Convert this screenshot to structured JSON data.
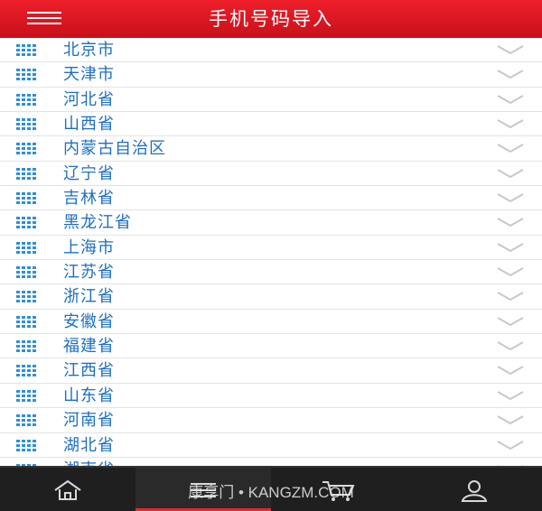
{
  "header": {
    "title": "手机号码导入"
  },
  "provinces": [
    "北京市",
    "天津市",
    "河北省",
    "山西省",
    "内蒙古自治区",
    "辽宁省",
    "吉林省",
    "黑龙江省",
    "上海市",
    "江苏省",
    "浙江省",
    "安徽省",
    "福建省",
    "江西省",
    "山东省",
    "河南省",
    "湖北省",
    "湖南省"
  ],
  "icons": {
    "row": "grid-list-icon",
    "chevron": "chevron-down-icon",
    "home": "home-icon",
    "list": "list-icon",
    "cart": "cart-icon",
    "user": "user-icon"
  },
  "colors": {
    "header": "#d8141f",
    "row_text": "#1d6fc0",
    "icon": "#2f8fd8",
    "tabbar": "#1f1f1f",
    "active_tab": "#e3292f"
  },
  "tabbar": {
    "active_index": 1
  },
  "watermark": "康享门 • KANGZM.COM"
}
